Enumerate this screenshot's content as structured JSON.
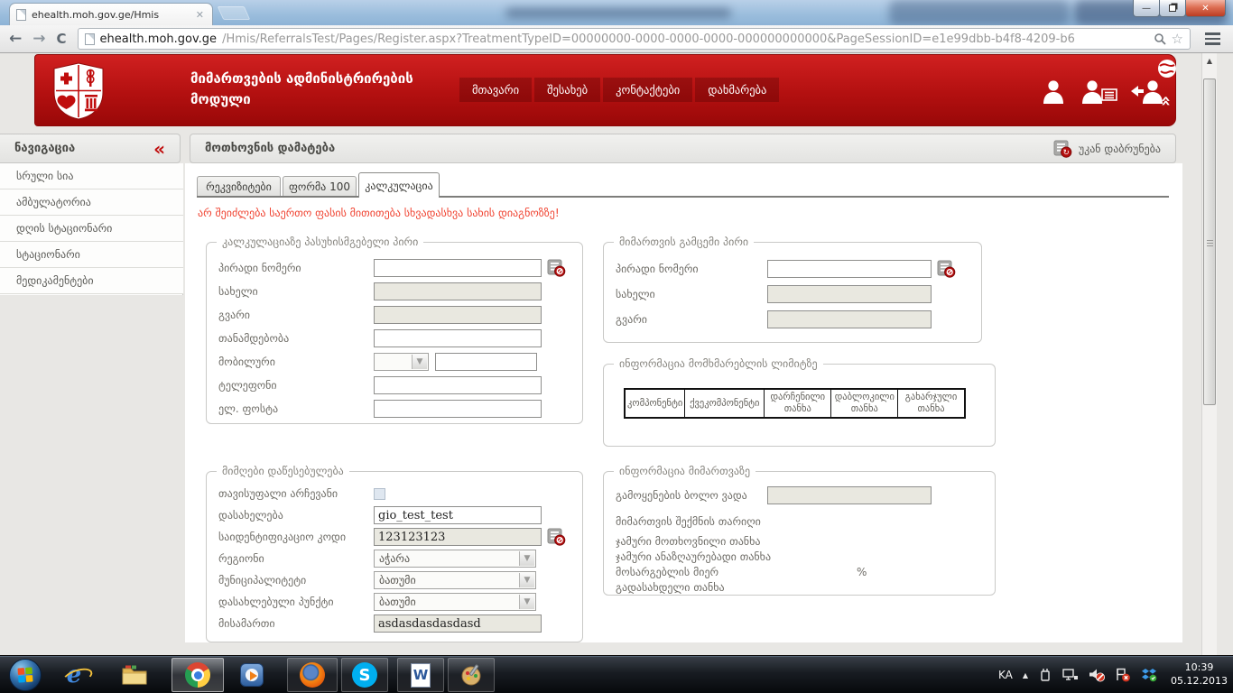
{
  "browser": {
    "tab_title": "ehealth.moh.gov.ge/Hmis",
    "url_domain": "ehealth.moh.gov.ge",
    "url_path": "/Hmis/ReferralsTest/Pages/Register.aspx?TreatmentTypeID=00000000-0000-0000-0000-000000000000&PageSessionID=e1e99dbb-b4f8-4209-b6"
  },
  "colors": {
    "header_red": "#b31010",
    "warning_red": "#f04331"
  },
  "app_header": {
    "title_line1": "მიმართვების ადმინისტრირების",
    "title_line2": "მოდული",
    "nav": [
      "მთავარი",
      "შესახებ",
      "კონტაქტები",
      "დახმარება"
    ]
  },
  "sidebar": {
    "title": "ნავიგაცია",
    "collapse_icon": "«",
    "items": [
      "სრული სია",
      "ამბულატორია",
      "დღის სტაციონარი",
      "სტაციონარი",
      "მედიკამენტები"
    ]
  },
  "page": {
    "title": "მოთხოვნის დამატება",
    "back_label": "უკან დაბრუნება",
    "tabs": [
      "რეკვიზიტები",
      "ფორმა 100",
      "კალკულაცია"
    ],
    "active_tab": "კალკულაცია",
    "warning": "არ შეიძლება საერთო ფასის მითითება სხვადასხვა სახის დიაგნოზზე!"
  },
  "calc_person": {
    "legend": "კალკულაციაზე პასუხისმგებელი პირი",
    "personal_number_label": "პირადი ნომერი",
    "name_label": "სახელი",
    "surname_label": "გვარი",
    "position_label": "თანამდებობა",
    "mobile_label": "მობილური",
    "phone_label": "ტელეფონი",
    "email_label": "ელ. ფოსტა"
  },
  "issuer_person": {
    "legend": "მიმართვის გამცემი პირი",
    "personal_number_label": "პირადი ნომერი",
    "name_label": "სახელი",
    "surname_label": "გვარი"
  },
  "limit_info": {
    "legend": "ინფორმაცია მომხმარებლის ლიმიტზე",
    "columns": [
      "კომპონენტი",
      "ქვეკომპონენტი",
      "დარჩენილი თანხა",
      "დაბლოკილი თანხა",
      "გახარჯული თანხა"
    ]
  },
  "institution": {
    "legend": "მიმღები დაწესებულება",
    "free_choice_label": "თავისუფალი არჩევანი",
    "name_label": "დასახელება",
    "name_value": "gio_test_test",
    "id_code_label": "საიდენტიფიკაციო კოდი",
    "id_code_value": "123123123",
    "region_label": "რეგიონი",
    "region_value": "აჭარა",
    "municipality_label": "მუნიციპალიტეტი",
    "municipality_value": "ბათუმი",
    "settlement_label": "დასახლებული პუნქტი",
    "settlement_value": "ბათუმი",
    "address_label": "მისამართი",
    "address_value": "asdasdasdasdasd"
  },
  "referral_info": {
    "legend": "ინფორმაცია მიმართვაზე",
    "expiry_label": "გამოყენების ბოლო ვადა",
    "created_label": "მიმართვის შექმნის თარიღი",
    "total_requested_label": "ჯამური მოთხოვნილი თანხა",
    "total_reimbursable_label": "ჯამური ანაზღაურებადი თანხა",
    "beneficiary_share_label": "მოსარგებლის მიერ",
    "percent_sign": "%",
    "payable_label": "გადასახდელი თანხა"
  },
  "taskbar": {
    "language": "KA",
    "time": "10:39",
    "date": "05.12.2013"
  }
}
